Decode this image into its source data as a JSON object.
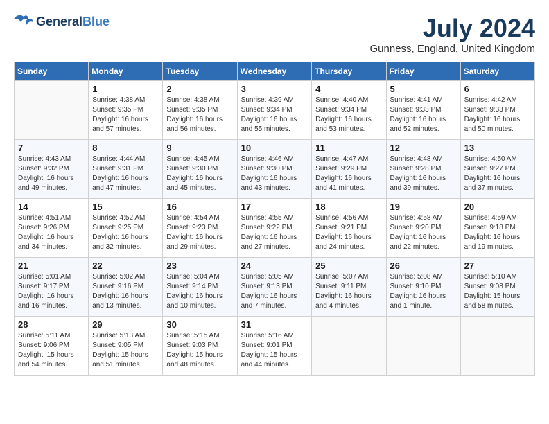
{
  "header": {
    "logo_general": "General",
    "logo_blue": "Blue",
    "month_year": "July 2024",
    "location": "Gunness, England, United Kingdom"
  },
  "days_of_week": [
    "Sunday",
    "Monday",
    "Tuesday",
    "Wednesday",
    "Thursday",
    "Friday",
    "Saturday"
  ],
  "weeks": [
    [
      {
        "day": "",
        "info": ""
      },
      {
        "day": "1",
        "info": "Sunrise: 4:38 AM\nSunset: 9:35 PM\nDaylight: 16 hours\nand 57 minutes."
      },
      {
        "day": "2",
        "info": "Sunrise: 4:38 AM\nSunset: 9:35 PM\nDaylight: 16 hours\nand 56 minutes."
      },
      {
        "day": "3",
        "info": "Sunrise: 4:39 AM\nSunset: 9:34 PM\nDaylight: 16 hours\nand 55 minutes."
      },
      {
        "day": "4",
        "info": "Sunrise: 4:40 AM\nSunset: 9:34 PM\nDaylight: 16 hours\nand 53 minutes."
      },
      {
        "day": "5",
        "info": "Sunrise: 4:41 AM\nSunset: 9:33 PM\nDaylight: 16 hours\nand 52 minutes."
      },
      {
        "day": "6",
        "info": "Sunrise: 4:42 AM\nSunset: 9:33 PM\nDaylight: 16 hours\nand 50 minutes."
      }
    ],
    [
      {
        "day": "7",
        "info": "Sunrise: 4:43 AM\nSunset: 9:32 PM\nDaylight: 16 hours\nand 49 minutes."
      },
      {
        "day": "8",
        "info": "Sunrise: 4:44 AM\nSunset: 9:31 PM\nDaylight: 16 hours\nand 47 minutes."
      },
      {
        "day": "9",
        "info": "Sunrise: 4:45 AM\nSunset: 9:30 PM\nDaylight: 16 hours\nand 45 minutes."
      },
      {
        "day": "10",
        "info": "Sunrise: 4:46 AM\nSunset: 9:30 PM\nDaylight: 16 hours\nand 43 minutes."
      },
      {
        "day": "11",
        "info": "Sunrise: 4:47 AM\nSunset: 9:29 PM\nDaylight: 16 hours\nand 41 minutes."
      },
      {
        "day": "12",
        "info": "Sunrise: 4:48 AM\nSunset: 9:28 PM\nDaylight: 16 hours\nand 39 minutes."
      },
      {
        "day": "13",
        "info": "Sunrise: 4:50 AM\nSunset: 9:27 PM\nDaylight: 16 hours\nand 37 minutes."
      }
    ],
    [
      {
        "day": "14",
        "info": "Sunrise: 4:51 AM\nSunset: 9:26 PM\nDaylight: 16 hours\nand 34 minutes."
      },
      {
        "day": "15",
        "info": "Sunrise: 4:52 AM\nSunset: 9:25 PM\nDaylight: 16 hours\nand 32 minutes."
      },
      {
        "day": "16",
        "info": "Sunrise: 4:54 AM\nSunset: 9:23 PM\nDaylight: 16 hours\nand 29 minutes."
      },
      {
        "day": "17",
        "info": "Sunrise: 4:55 AM\nSunset: 9:22 PM\nDaylight: 16 hours\nand 27 minutes."
      },
      {
        "day": "18",
        "info": "Sunrise: 4:56 AM\nSunset: 9:21 PM\nDaylight: 16 hours\nand 24 minutes."
      },
      {
        "day": "19",
        "info": "Sunrise: 4:58 AM\nSunset: 9:20 PM\nDaylight: 16 hours\nand 22 minutes."
      },
      {
        "day": "20",
        "info": "Sunrise: 4:59 AM\nSunset: 9:18 PM\nDaylight: 16 hours\nand 19 minutes."
      }
    ],
    [
      {
        "day": "21",
        "info": "Sunrise: 5:01 AM\nSunset: 9:17 PM\nDaylight: 16 hours\nand 16 minutes."
      },
      {
        "day": "22",
        "info": "Sunrise: 5:02 AM\nSunset: 9:16 PM\nDaylight: 16 hours\nand 13 minutes."
      },
      {
        "day": "23",
        "info": "Sunrise: 5:04 AM\nSunset: 9:14 PM\nDaylight: 16 hours\nand 10 minutes."
      },
      {
        "day": "24",
        "info": "Sunrise: 5:05 AM\nSunset: 9:13 PM\nDaylight: 16 hours\nand 7 minutes."
      },
      {
        "day": "25",
        "info": "Sunrise: 5:07 AM\nSunset: 9:11 PM\nDaylight: 16 hours\nand 4 minutes."
      },
      {
        "day": "26",
        "info": "Sunrise: 5:08 AM\nSunset: 9:10 PM\nDaylight: 16 hours\nand 1 minute."
      },
      {
        "day": "27",
        "info": "Sunrise: 5:10 AM\nSunset: 9:08 PM\nDaylight: 15 hours\nand 58 minutes."
      }
    ],
    [
      {
        "day": "28",
        "info": "Sunrise: 5:11 AM\nSunset: 9:06 PM\nDaylight: 15 hours\nand 54 minutes."
      },
      {
        "day": "29",
        "info": "Sunrise: 5:13 AM\nSunset: 9:05 PM\nDaylight: 15 hours\nand 51 minutes."
      },
      {
        "day": "30",
        "info": "Sunrise: 5:15 AM\nSunset: 9:03 PM\nDaylight: 15 hours\nand 48 minutes."
      },
      {
        "day": "31",
        "info": "Sunrise: 5:16 AM\nSunset: 9:01 PM\nDaylight: 15 hours\nand 44 minutes."
      },
      {
        "day": "",
        "info": ""
      },
      {
        "day": "",
        "info": ""
      },
      {
        "day": "",
        "info": ""
      }
    ]
  ]
}
